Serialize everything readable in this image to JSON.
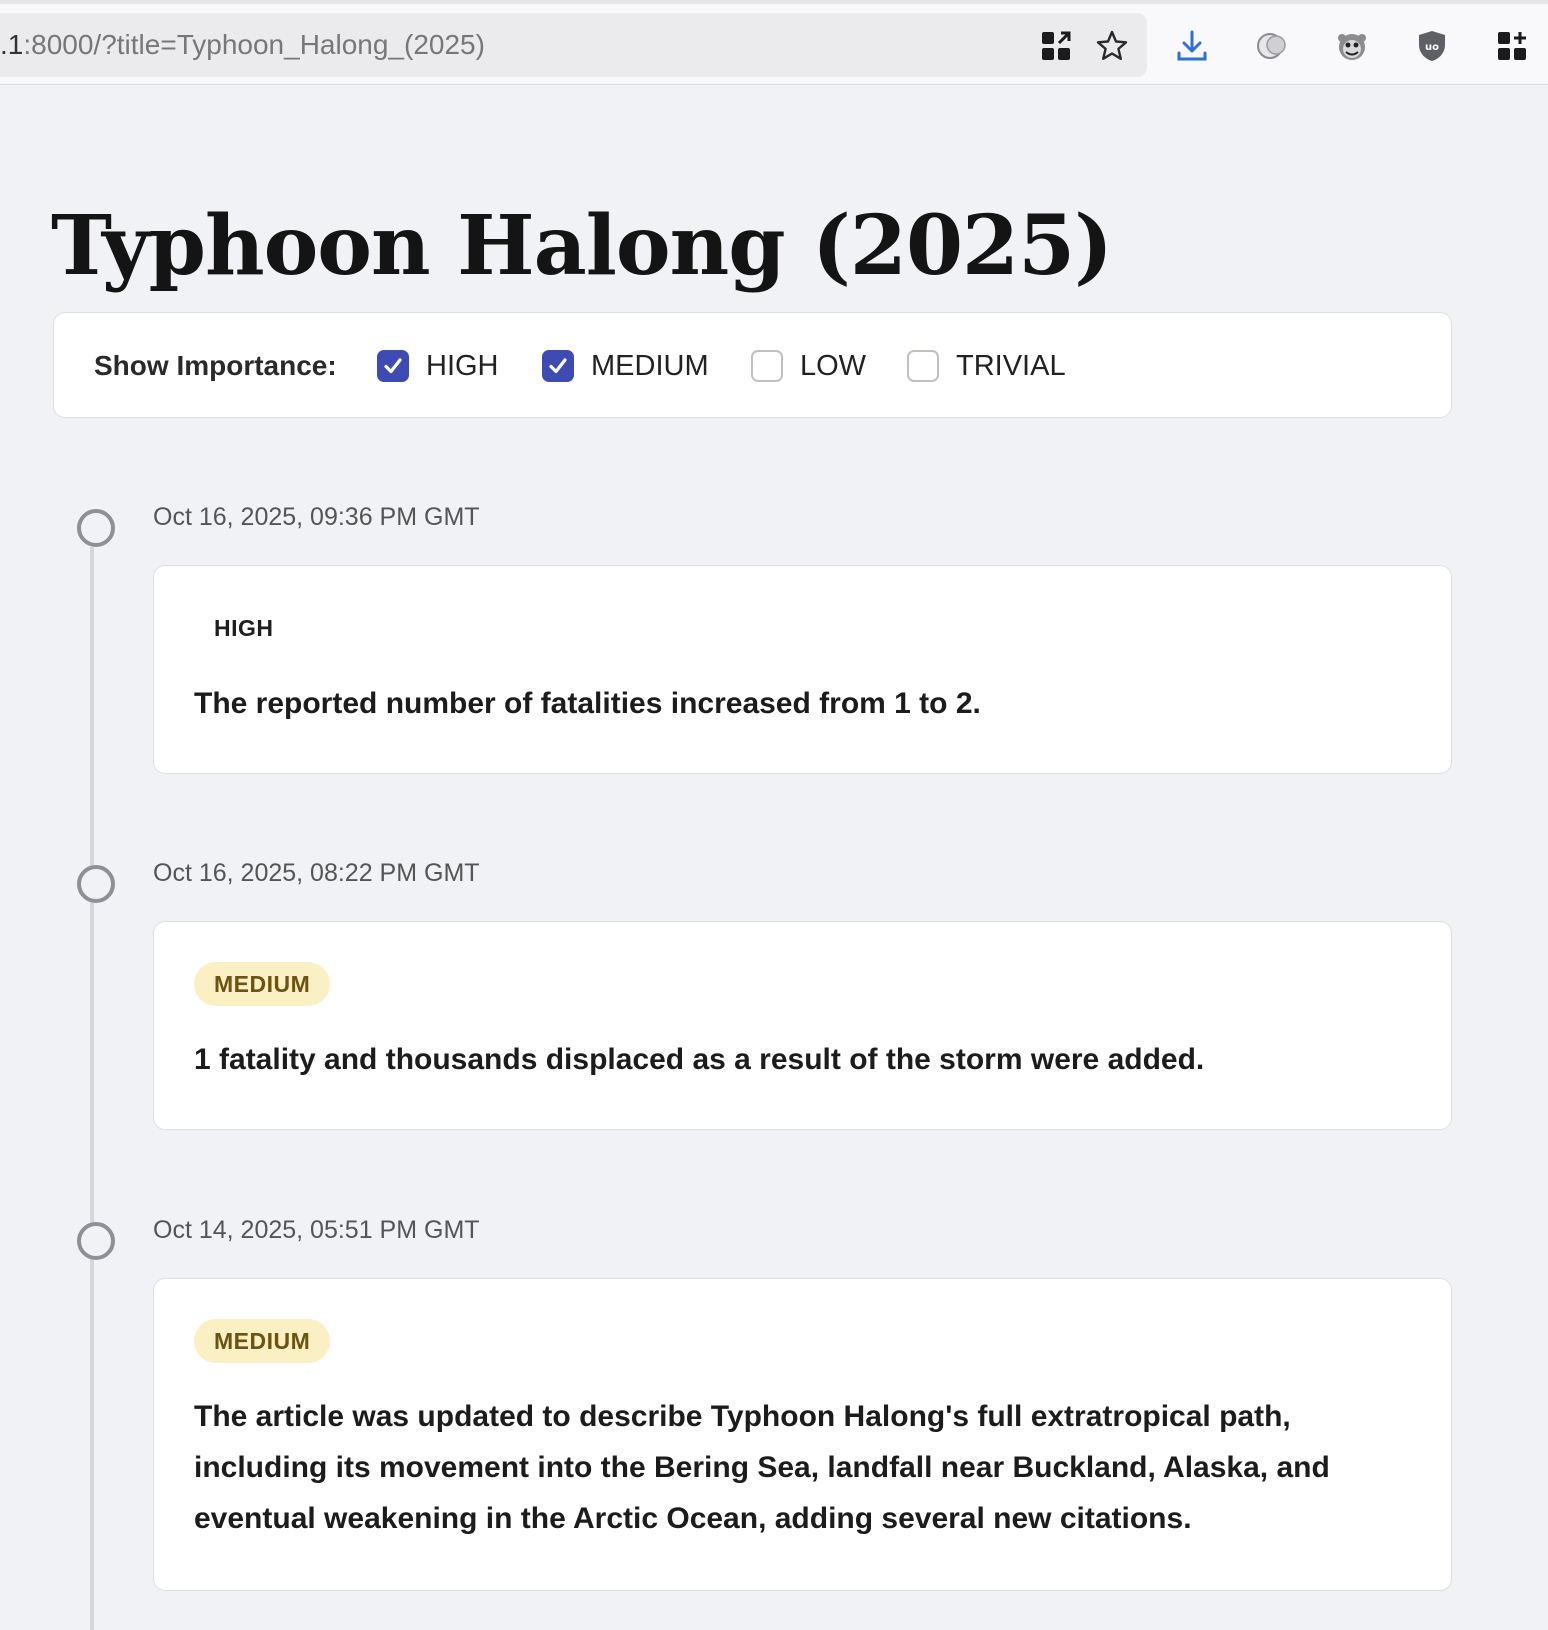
{
  "browser": {
    "url_host": ".1",
    "url_rest": ":8000/?title=Typhoon_Halong_(2025)",
    "toolbar_icons": [
      "qr-code-icon",
      "bookmark-star-icon",
      "download-icon",
      "extension-bubble-icon",
      "extension-monkey-icon",
      "ublock-shield-icon",
      "extensions-grid-icon"
    ]
  },
  "page": {
    "title": "Typhoon Halong (2025)"
  },
  "filter": {
    "label": "Show Importance:",
    "options": [
      {
        "label": "HIGH",
        "checked": true
      },
      {
        "label": "MEDIUM",
        "checked": true
      },
      {
        "label": "LOW",
        "checked": false
      },
      {
        "label": "TRIVIAL",
        "checked": false
      }
    ]
  },
  "colors": {
    "accent_checkbox": "#3f4bb5",
    "medium_badge_bg": "#fbefc4",
    "medium_badge_text": "#6b5310",
    "page_bg": "#f1f2f5"
  },
  "timeline": [
    {
      "timestamp": "Oct 16, 2025, 09:36 PM GMT",
      "importance": "HIGH",
      "text": "The reported number of fatalities increased from 1 to 2."
    },
    {
      "timestamp": "Oct 16, 2025, 08:22 PM GMT",
      "importance": "MEDIUM",
      "text": "1 fatality and thousands displaced as a result of the storm were added."
    },
    {
      "timestamp": "Oct 14, 2025, 05:51 PM GMT",
      "importance": "MEDIUM",
      "text": "The article was updated to describe Typhoon Halong's full extratropical path, including its movement into the Bering Sea, landfall near Buckland, Alaska, and eventual weakening in the Arctic Ocean, adding several new citations."
    }
  ]
}
